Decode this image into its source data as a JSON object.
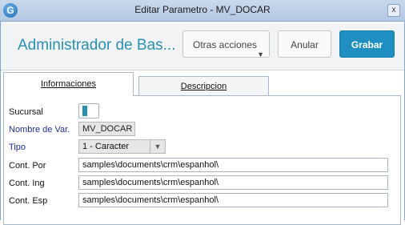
{
  "window": {
    "title": "Editar Parametro - MV_DOCAR",
    "close_label": "x",
    "app_icon_glyph": "G"
  },
  "header": {
    "heading": "Administrador de Bas...",
    "buttons": {
      "otras": "Otras acciones",
      "anular": "Anular",
      "grabar": "Grabar"
    },
    "accent_color": "#1f8ec1"
  },
  "tabs": [
    {
      "label": "Informaciones",
      "active": true
    },
    {
      "label": "Descripcion",
      "active": false
    }
  ],
  "form": {
    "sucursal": {
      "label": "Sucursal",
      "toggle_on": false
    },
    "nombre": {
      "label": "Nombre de Var.",
      "value": "MV_DOCAR"
    },
    "tipo": {
      "label": "Tipo",
      "value": "1 - Caracter"
    },
    "cont_por": {
      "label": "Cont. Por",
      "value": "samples\\documents\\crm\\espanhol\\"
    },
    "cont_ing": {
      "label": "Cont. Ing",
      "value": "samples\\documents\\crm\\espanhol\\"
    },
    "cont_esp": {
      "label": "Cont. Esp",
      "value": "samples\\documents\\crm\\espanhol\\"
    }
  }
}
